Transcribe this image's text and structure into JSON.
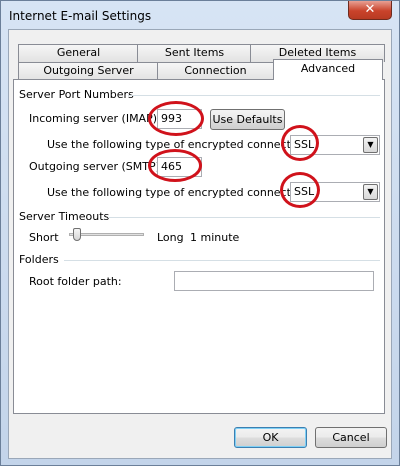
{
  "window": {
    "title": "Internet E-mail Settings",
    "close_glyph": "✕"
  },
  "tabs": {
    "row1": [
      {
        "label": "General"
      },
      {
        "label": "Sent Items"
      },
      {
        "label": "Deleted Items"
      }
    ],
    "row2": [
      {
        "label": "Outgoing Server"
      },
      {
        "label": "Connection"
      },
      {
        "label": "Advanced"
      }
    ],
    "active": "Advanced"
  },
  "server_ports": {
    "section_title": "Server Port Numbers",
    "incoming_label": "Incoming server (IMAP):",
    "incoming_value": "993",
    "use_defaults_label": "Use Defaults",
    "incoming_encryption_label": "Use the following type of encrypted connection:",
    "incoming_encryption_value": "SSL",
    "outgoing_label": "Outgoing server (SMTP):",
    "outgoing_value": "465",
    "outgoing_encryption_label": "Use the following type of encrypted connection:",
    "outgoing_encryption_value": "SSL"
  },
  "timeouts": {
    "section_title": "Server Timeouts",
    "short_label": "Short",
    "long_label": "Long",
    "value_label": "1 minute",
    "slider_level": 0.1
  },
  "folders": {
    "section_title": "Folders",
    "root_path_label": "Root folder path:",
    "root_path_value": ""
  },
  "footer": {
    "ok_label": "OK",
    "cancel_label": "Cancel"
  },
  "colors": {
    "annotation": "#d0121b",
    "close": "#c9432b"
  },
  "icons": {
    "close": "close-icon",
    "dropdown": "chevron-down-icon"
  }
}
